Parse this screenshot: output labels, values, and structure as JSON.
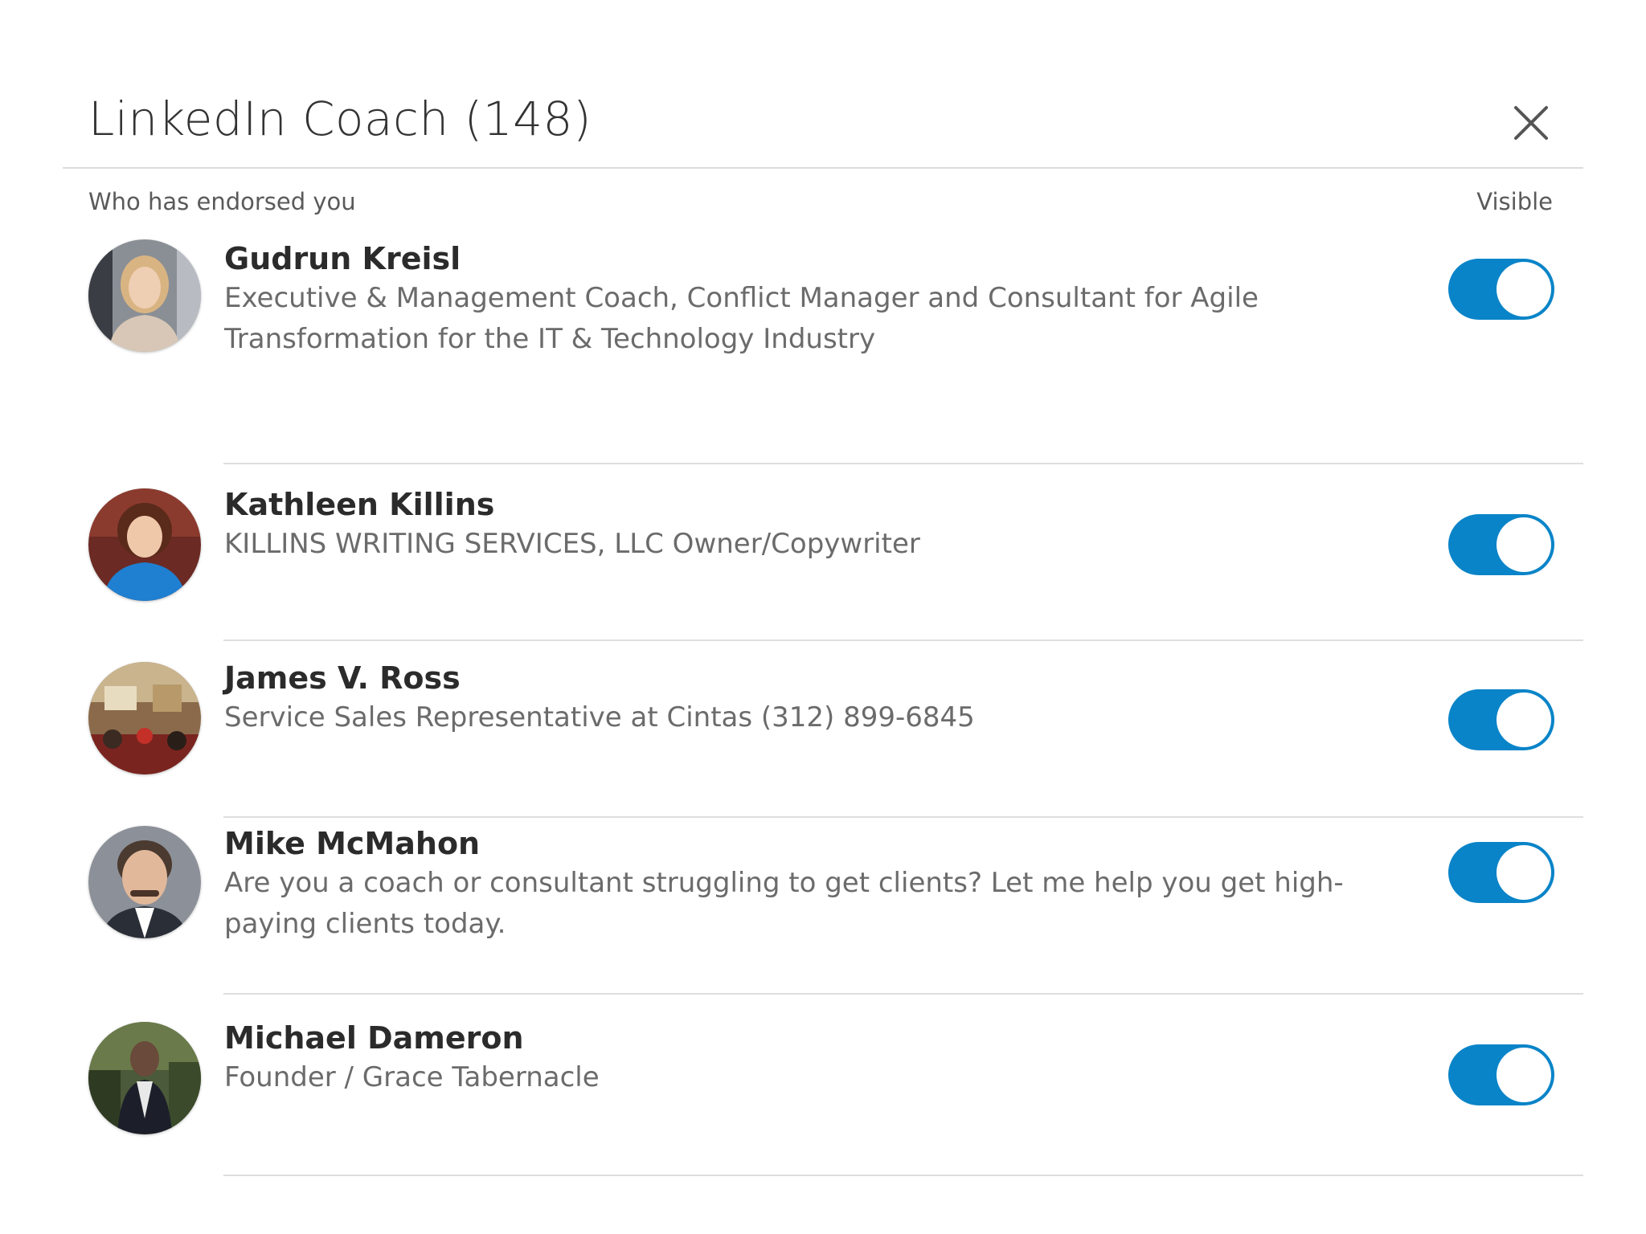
{
  "modal": {
    "title": "LinkedIn Coach (148)",
    "close_icon": "close-icon"
  },
  "subheader": {
    "left_label": "Who has endorsed you",
    "right_label": "Visible"
  },
  "colors": {
    "toggle_on": "#0a84c8",
    "divider": "#dedede"
  },
  "endorsers": [
    {
      "name": "Gudrun Kreisl",
      "description": "Executive & Management Coach, Conflict Manager and Consultant for Agile Transformation for the IT & Technology Industry",
      "visible": true
    },
    {
      "name": "Kathleen Killins",
      "description": "KILLINS WRITING SERVICES, LLC Owner/Copywriter",
      "visible": true
    },
    {
      "name": "James V. Ross",
      "description": "Service Sales Representative at Cintas (312) 899-6845",
      "visible": true
    },
    {
      "name": "Mike McMahon",
      "description": "Are you a coach or consultant struggling to get clients? Let me help you get high-paying clients today.",
      "visible": true
    },
    {
      "name": "Michael Dameron",
      "description": "Founder / Grace Tabernacle",
      "visible": true
    }
  ]
}
